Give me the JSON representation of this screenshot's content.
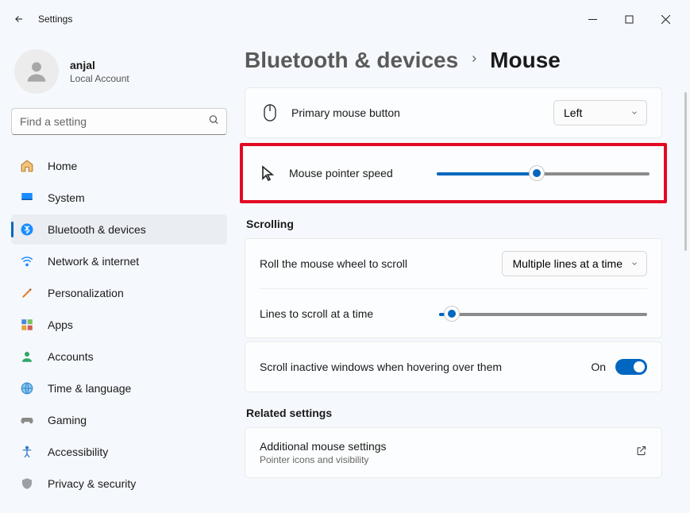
{
  "titlebar": {
    "title": "Settings"
  },
  "profile": {
    "name": "anjal",
    "subtitle": "Local Account"
  },
  "search": {
    "placeholder": "Find a setting"
  },
  "sidebar": {
    "items": [
      {
        "label": "Home"
      },
      {
        "label": "System"
      },
      {
        "label": "Bluetooth & devices"
      },
      {
        "label": "Network & internet"
      },
      {
        "label": "Personalization"
      },
      {
        "label": "Apps"
      },
      {
        "label": "Accounts"
      },
      {
        "label": "Time & language"
      },
      {
        "label": "Gaming"
      },
      {
        "label": "Accessibility"
      },
      {
        "label": "Privacy & security"
      }
    ]
  },
  "breadcrumb": {
    "parent": "Bluetooth & devices",
    "current": "Mouse"
  },
  "primary_button": {
    "label": "Primary mouse button",
    "value": "Left"
  },
  "pointer_speed": {
    "label": "Mouse pointer speed",
    "value_percent": 47
  },
  "scrolling": {
    "heading": "Scrolling",
    "roll_label": "Roll the mouse wheel to scroll",
    "roll_value": "Multiple lines at a time",
    "lines_label": "Lines to scroll at a time",
    "lines_value_percent": 6,
    "inactive_label": "Scroll inactive windows when hovering over them",
    "inactive_state": "On"
  },
  "related": {
    "heading": "Related settings",
    "additional_title": "Additional mouse settings",
    "additional_sub": "Pointer icons and visibility"
  }
}
